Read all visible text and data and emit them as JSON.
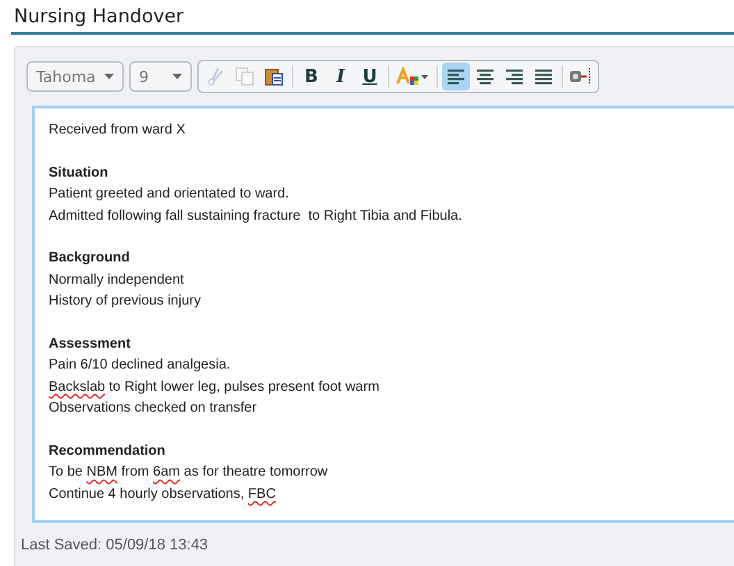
{
  "title": "Nursing Handover",
  "toolbar": {
    "font": "Tahoma",
    "size": "9",
    "groups": [
      [
        {
          "kind": "cut",
          "disabled": true,
          "selected": false
        },
        {
          "kind": "copy",
          "disabled": true,
          "selected": false
        },
        {
          "kind": "paste",
          "disabled": false,
          "selected": false
        }
      ],
      [
        {
          "kind": "bold",
          "label": "B",
          "selected": false
        },
        {
          "kind": "italic",
          "label": "I",
          "selected": false
        },
        {
          "kind": "underline",
          "label": "U",
          "selected": false
        }
      ],
      [
        {
          "kind": "font-color",
          "selected": false
        }
      ],
      [
        {
          "kind": "align-left",
          "selected": true
        },
        {
          "kind": "align-center",
          "selected": false
        },
        {
          "kind": "align-right",
          "selected": false
        },
        {
          "kind": "justify",
          "selected": false
        }
      ],
      [
        {
          "kind": "field",
          "selected": false
        }
      ]
    ]
  },
  "editor": {
    "blocks": [
      {
        "lines": [
          [
            {
              "text": "Received from ward X",
              "misspelled": false
            }
          ]
        ]
      },
      {
        "heading": "Situation",
        "lines": [
          [
            {
              "text": "Patient greeted and orientated to ward.",
              "misspelled": false
            }
          ],
          [
            {
              "text": "Admitted following fall sustaining fracture  to Right Tibia and Fibula.",
              "misspelled": false
            }
          ]
        ]
      },
      {
        "heading": "Background",
        "lines": [
          [
            {
              "text": "Normally independent",
              "misspelled": false
            }
          ],
          [
            {
              "text": "History of previous injury",
              "misspelled": false
            }
          ]
        ]
      },
      {
        "heading": "Assessment",
        "lines": [
          [
            {
              "text": "Pain 6/10 declined analgesia.",
              "misspelled": false
            }
          ],
          [
            {
              "text": "Backslab",
              "misspelled": true
            },
            {
              "text": " to Right lower leg, pulses present foot warm",
              "misspelled": false
            }
          ],
          [
            {
              "text": "Observations checked on transfer",
              "misspelled": false
            }
          ]
        ]
      },
      {
        "heading": "Recommendation",
        "lines": [
          [
            {
              "text": "To be ",
              "misspelled": false
            },
            {
              "text": "NBM",
              "misspelled": true
            },
            {
              "text": " from ",
              "misspelled": false
            },
            {
              "text": "6am",
              "misspelled": true
            },
            {
              "text": " as for theatre tomorrow",
              "misspelled": false
            }
          ],
          [
            {
              "text": "Continue 4 hourly observations, ",
              "misspelled": false
            },
            {
              "text": "FBC",
              "misspelled": true
            }
          ]
        ]
      }
    ]
  },
  "status": "Last Saved: 05/09/18 13:43"
}
